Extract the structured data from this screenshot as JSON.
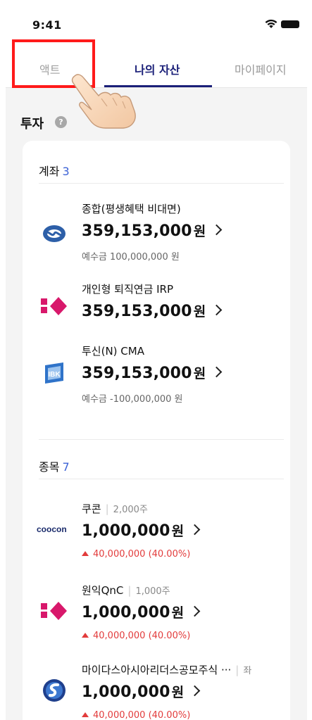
{
  "status": {
    "time": "9:41"
  },
  "tabs": [
    {
      "label": "액트"
    },
    {
      "label": "나의 자산",
      "active": true
    },
    {
      "label": "마이페이지"
    }
  ],
  "invest": {
    "title": "투자",
    "help": "?"
  },
  "accounts": {
    "label": "계좌",
    "count": "3",
    "items": [
      {
        "name": "종합(평생혜택 비대면)",
        "amount": "359,153,000",
        "unit": "원",
        "deposit": "예수금 100,000,000 원",
        "logo": "blue-bank-logo"
      },
      {
        "name": "개인형 퇴직연금 IRP",
        "amount": "359,153,000",
        "unit": "원",
        "logo": "pink-diamond-logo"
      },
      {
        "name": "투신(N) CMA",
        "amount": "359,153,000",
        "unit": "원",
        "deposit": "예수금 -100,000,000 원",
        "logo": "ibk-logo"
      }
    ]
  },
  "stocks": {
    "label": "종목",
    "count": "7",
    "items": [
      {
        "name": "쿠콘",
        "qty": "2,000주",
        "amount": "1,000,000",
        "unit": "원",
        "change": "40,000,000 (40.00%)",
        "logo": "coocon-logo",
        "logo_text": "coocon"
      },
      {
        "name": "원익QnC",
        "qty": "1,000주",
        "amount": "1,000,000",
        "unit": "원",
        "change": "40,000,000 (40.00%)",
        "logo": "pink-diamond-logo"
      },
      {
        "name": "마이다스아시아리더스공모주식 ···",
        "qty": "좌",
        "amount": "1,000,000",
        "unit": "원",
        "change": "40,000,000 (40.00%)",
        "logo": "shinhan-logo"
      }
    ]
  },
  "colors": {
    "accent": "#1a1f78",
    "count_blue": "#3d63d6",
    "up_red": "#e23b3b",
    "highlight": "#ff1a1a"
  }
}
